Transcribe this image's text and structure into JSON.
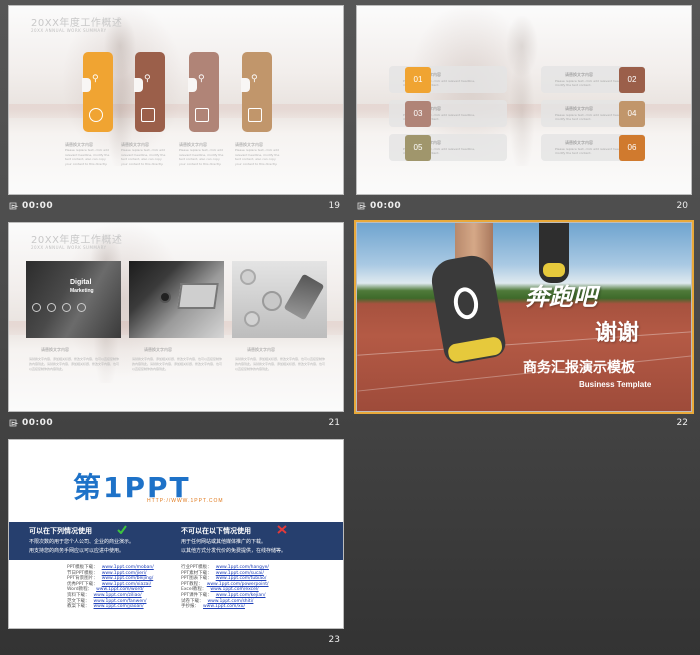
{
  "slides": [
    {
      "number": "19",
      "time": "00:00",
      "title": "20XX年度工作概述",
      "subtitle": "20XX ANNUAL WORK SUMMARY",
      "captions": [
        "请替换文字内容",
        "请替换文字内容",
        "请替换文字内容",
        "请替换文字内容"
      ],
      "desc": "Please replace text, click add relevant headline, modify the text content, also can copy your content to this directly."
    },
    {
      "number": "20",
      "time": "00:00",
      "items": [
        "01",
        "02",
        "03",
        "04",
        "05",
        "06"
      ],
      "item_title": "请替换文字内容",
      "item_desc": "Please replace text, click add relevant headline, modify the text content."
    },
    {
      "number": "21",
      "time": "00:00",
      "title": "20XX年度工作概述",
      "subtitle": "20XX ANNUAL WORK SUMMARY",
      "photo1_text": [
        "Digital",
        "Marketing"
      ],
      "captions": [
        "请替换文字内容",
        "请替换文字内容",
        "请替换文字内容"
      ],
      "desc": "请替换文字内容，添加相关标题，修改文字内容，也可以直接复制你的内容到此。请替换文字内容，添加相关标题，修改文字内容，也可以直接复制你的内容到此。"
    },
    {
      "number": "22",
      "headline": "奔跑吧",
      "thanks": "谢谢",
      "subtitle": "商务汇报演示模板",
      "business_en": "Business Template"
    },
    {
      "number": "23",
      "logo_main": "第1PPT",
      "logo_url": "HTTP://WWW.1PPT.COM",
      "can_use_title": "可以在下列情况使用",
      "can_use_items": [
        "不限次数的用于您个人公司、企业的商业演示。",
        "用支持您的商务手网应以可以应进中使用。"
      ],
      "cannot_use_title": "不可以在以下情况使用",
      "cannot_use_items": [
        "用于任何网站或其他媒体推广的下载。",
        "以其他方式分发代价的免费提供，在线存储等。"
      ],
      "links_left": [
        {
          "label": "PPT模板下载：",
          "url": "www.1ppt.com/moban/"
        },
        {
          "label": "节日PPT模板：",
          "url": "www.1ppt.com/jieri/"
        },
        {
          "label": "PPT背景图片：",
          "url": "www.1ppt.com/beijing/"
        },
        {
          "label": "优秀PPT下载：",
          "url": "www.1ppt.com/xiazai/"
        },
        {
          "label": "Word教程：",
          "url": "www.1ppt.com/word/"
        },
        {
          "label": "资料下载：",
          "url": "www.1ppt.com/ziliao/"
        },
        {
          "label": "范文下载：",
          "url": "www.1ppt.com/fanwen/"
        },
        {
          "label": "教案下载：",
          "url": "www.1ppt.com/jiaoan/"
        }
      ],
      "links_right": [
        {
          "label": "行业PPT模板：",
          "url": "www.1ppt.com/hangye/"
        },
        {
          "label": "PPT素材下载：",
          "url": "www.1ppt.com/sucai/"
        },
        {
          "label": "PPT图表下载：",
          "url": "www.1ppt.com/tubiao/"
        },
        {
          "label": "PPT教程：",
          "url": "www.1ppt.com/powerpoint/"
        },
        {
          "label": "Excel教程：",
          "url": "www.1ppt.com/excel/"
        },
        {
          "label": "PPT课件下载：",
          "url": "www.1ppt.com/kejian/"
        },
        {
          "label": "试卷下载：",
          "url": "www.1ppt.com/shiti/"
        },
        {
          "label": "手抄报：",
          "url": "www.1ppt.com/xu/"
        }
      ]
    }
  ],
  "colors": {
    "orange": "#f0a432",
    "brown": "#9b5f4a",
    "mauve": "#b08477",
    "tan": "#c1966b",
    "olive": "#a0966c",
    "navy": "#263f6e",
    "blue": "#1e72c8"
  }
}
